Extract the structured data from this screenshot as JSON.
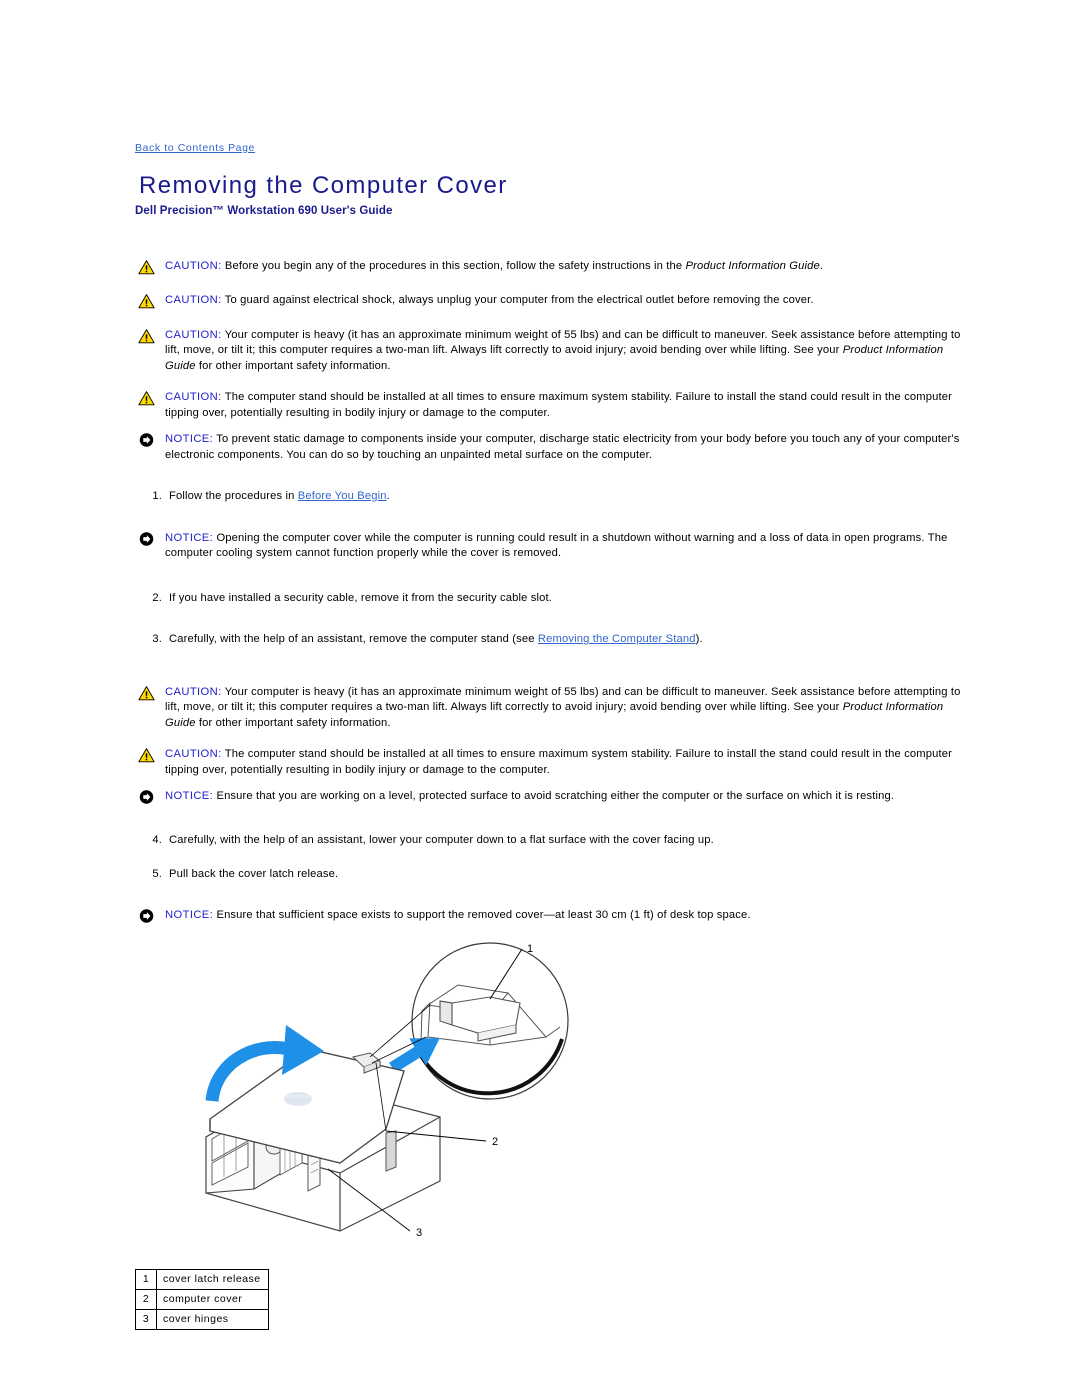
{
  "page": {
    "back_link": "Back to Contents Page",
    "title": "Removing the Computer Cover",
    "subtitle": "Dell Precision™ Workstation 690 User's Guide"
  },
  "labels": {
    "caution": "CAUTION:",
    "notice": "NOTICE:"
  },
  "blocks": [
    {
      "kind": "caution",
      "id": "caution-safety-instructions",
      "text_before": "Before you begin any of the procedures in this section, follow the safety instructions in the ",
      "italic": "Product Information Guide",
      "text_after": "."
    },
    {
      "kind": "caution",
      "id": "caution-electrical-shock",
      "text_before": "To guard against electrical shock, always unplug your computer from the electrical outlet before removing the cover.",
      "italic": "",
      "text_after": ""
    },
    {
      "kind": "caution",
      "id": "caution-heavy-computer-1",
      "text_before": "Your computer is heavy (it has an approximate minimum weight of 55 lbs) and can be difficult to maneuver. Seek assistance before attempting to lift, move, or tilt it; this computer requires a two-man lift. Always lift correctly to avoid injury; avoid bending over while lifting. See your ",
      "italic": "Product Information Guide",
      "text_after": " for other important safety information."
    },
    {
      "kind": "caution",
      "id": "caution-computer-stand-1",
      "text_before": "The computer stand should be installed at all times to ensure maximum system stability. Failure to install the stand could result in the computer tipping over, potentially resulting in bodily injury or damage to the computer.",
      "italic": "",
      "text_after": ""
    },
    {
      "kind": "notice",
      "id": "notice-static-damage",
      "text_before": "To prevent static damage to components inside your computer, discharge static electricity from your body before you touch any of your computer's electronic components. You can do so by touching an unpainted metal surface on the computer.",
      "italic": "",
      "text_after": ""
    }
  ],
  "step1": {
    "number": "1.",
    "text_before": "Follow the procedures in ",
    "link": "Before You Begin",
    "text_after": "."
  },
  "notice_open_cover": {
    "text": "Opening the computer cover while the computer is running could result in a shutdown without warning and a loss of data in open programs. The computer cooling system cannot function properly while the cover is removed."
  },
  "step2": {
    "number": "2.",
    "text": "If you have installed a security cable, remove it from the security cable slot."
  },
  "step3": {
    "number": "3.",
    "text_before": "Carefully, with the help of an assistant, remove the computer stand (see ",
    "link": "Removing the Computer Stand",
    "text_after": ")."
  },
  "blocks2": [
    {
      "kind": "caution",
      "id": "caution-heavy-computer-2",
      "text_before": "Your computer is heavy (it has an approximate minimum weight of 55 lbs) and can be difficult to maneuver. Seek assistance before attempting to lift, move, or tilt it; this computer requires a two-man lift. Always lift correctly to avoid injury; avoid bending over while lifting. See your ",
      "italic": "Product Information Guide",
      "text_after": " for other important safety information."
    },
    {
      "kind": "caution",
      "id": "caution-computer-stand-2",
      "text_before": "The computer stand should be installed at all times to ensure maximum system stability. Failure to install the stand could result in the computer tipping over, potentially resulting in bodily injury or damage to the computer.",
      "italic": "",
      "text_after": ""
    },
    {
      "kind": "notice",
      "id": "notice-level-surface",
      "text_before": "Ensure that you are working on a level, protected surface to avoid scratching either the computer or the surface on which it is resting.",
      "italic": "",
      "text_after": ""
    }
  ],
  "step4": {
    "number": "4.",
    "text": "Carefully, with the help of an assistant, lower your computer down to a flat surface with the cover facing up."
  },
  "step5": {
    "number": "5.",
    "text": "Pull back the cover latch release."
  },
  "notice_space": {
    "text": "Ensure that sufficient space exists to support the removed cover—at least 30 cm (1 ft) of desk top space."
  },
  "figure": {
    "callouts": [
      {
        "number": "1"
      },
      {
        "number": "2"
      },
      {
        "number": "3"
      }
    ]
  },
  "legend": {
    "rows": [
      {
        "key": "1",
        "label": "cover latch release"
      },
      {
        "key": "2",
        "label": "computer cover"
      },
      {
        "key": "3",
        "label": "cover hinges"
      }
    ]
  },
  "colors": {
    "title": "#1a1a8c",
    "label": "#2222cc",
    "link": "#3366cc",
    "arrow": "#1e90e8",
    "warn_triangle": "#ffd900"
  }
}
